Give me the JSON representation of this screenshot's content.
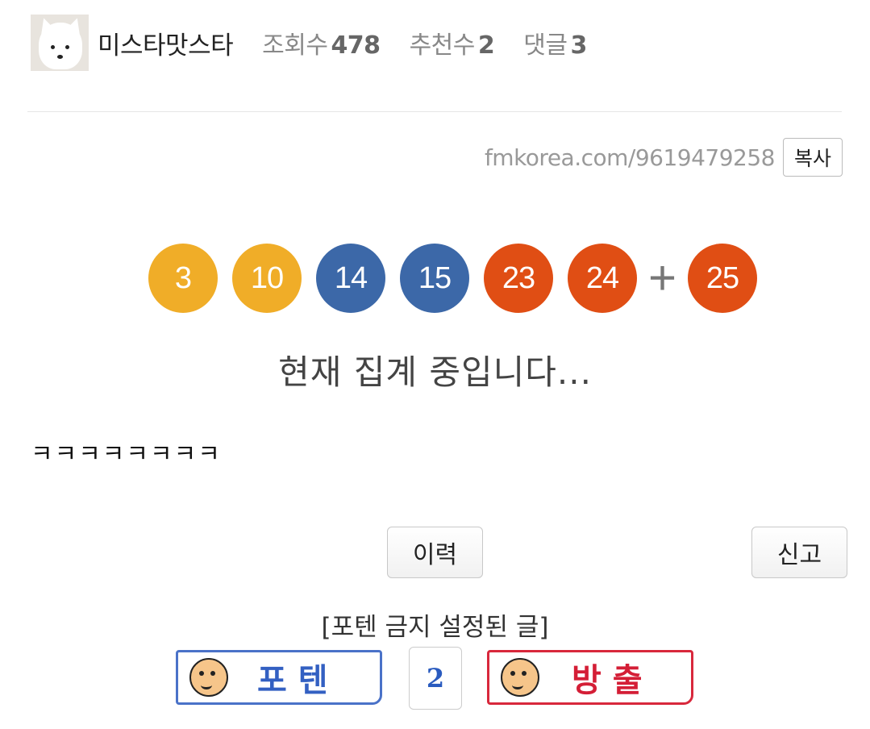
{
  "author": {
    "name": "미스타맛스타",
    "avatar_icon": "arctic-fox-avatar"
  },
  "stats": [
    {
      "label": "조회수",
      "value": "478"
    },
    {
      "label": "추천수",
      "value": "2"
    },
    {
      "label": "댓글",
      "value": "3"
    }
  ],
  "post": {
    "url": "fmkorea.com/9619479258",
    "copy_label": "복사",
    "body": "ㅋㅋㅋㅋㅋㅋㅋㅋ"
  },
  "lotto": {
    "numbers": [
      "3",
      "10",
      "14",
      "15",
      "23",
      "24"
    ],
    "bonus": "25",
    "plus_sign": "+",
    "status": "현재 집계 중입니다...",
    "colors": {
      "yellow": "#f0ad28",
      "blue": "#3c68a8",
      "red": "#e04e14"
    }
  },
  "actions": {
    "history_label": "이력",
    "report_label": "신고"
  },
  "vote": {
    "notice": "[포텐 금지 설정된 글]",
    "up_label": "포텐",
    "down_label": "방출",
    "count": "2",
    "up_color": "#4a72c8",
    "down_color": "#d8283c"
  }
}
